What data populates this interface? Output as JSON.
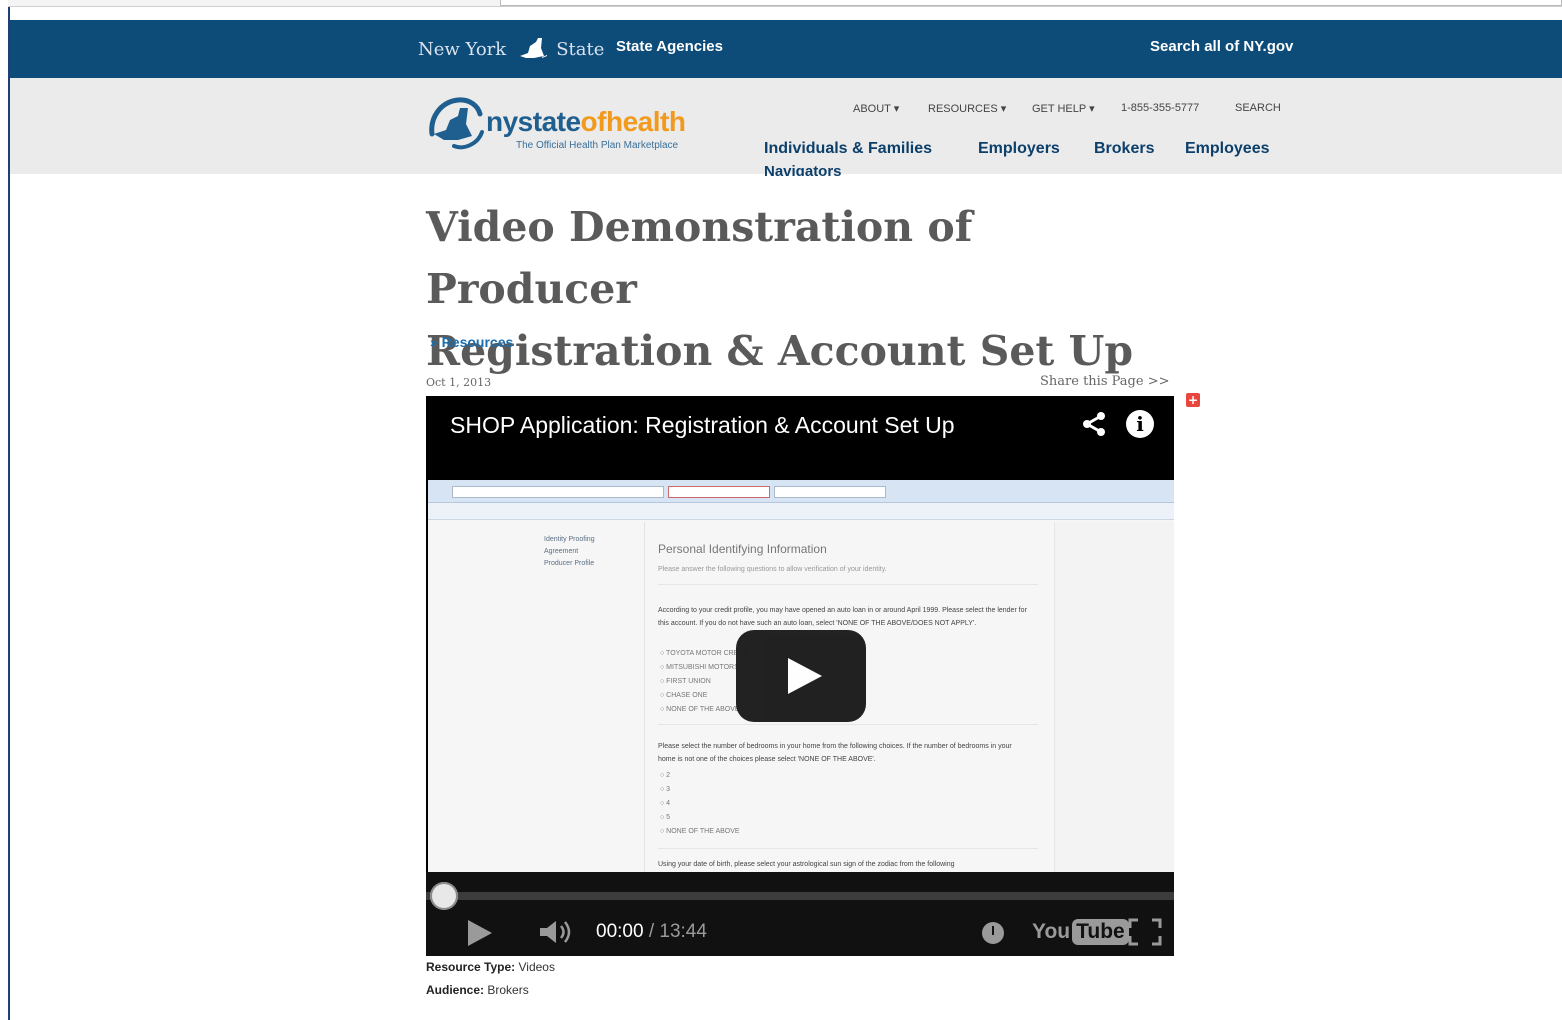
{
  "state_bar": {
    "brand_left": "New York",
    "brand_right": "State",
    "agencies": "State Agencies",
    "search": "Search all of NY.gov"
  },
  "site": {
    "logo_part1": "nystate",
    "logo_part2": "ofhealth",
    "logo_tagline": "The Official Health Plan Marketplace",
    "util_nav": [
      "ABOUT ▾",
      "RESOURCES ▾",
      "GET HELP ▾",
      "1-855-355-5777",
      "SEARCH"
    ],
    "main_nav": [
      "Individuals & Families",
      "Employers",
      "Brokers",
      "Employees",
      "Navigators"
    ]
  },
  "page": {
    "title_line1": "Video Demonstration of Producer",
    "title_line2": "Registration & Account Set Up",
    "breadcrumb": "» Resources",
    "date": "Oct 1, 2013",
    "share": "Share this Page >>"
  },
  "video": {
    "title": "SHOP Application: Registration & Account Set Up",
    "time_current": "00:00",
    "time_total": "/ 13:44",
    "progress": 0.0,
    "brand": "You",
    "brand_tube": "Tube",
    "thumbnail": {
      "side_items": [
        "Identity Proofing",
        "Agreement",
        "Producer Profile"
      ],
      "section_title": "Personal Identifying Information",
      "hint": "Please answer the following questions to allow verification of your identity.",
      "question1": "According to your credit profile, you may have opened an auto loan in or around April 1999. Please select the lender for this account. If you do not have such an auto loan, select 'NONE OF THE ABOVE/DOES NOT APPLY'.",
      "options1": [
        "○ TOYOTA MOTOR CREDIT",
        "○ MITSUBISHI MOTORS",
        "○ FIRST UNION",
        "○ CHASE ONE",
        "○ NONE OF THE ABOVE"
      ],
      "question2": "Please select the number of bedrooms in your home from the following choices. If the number of bedrooms in your home is not one of the choices please select 'NONE OF THE ABOVE'.",
      "options2": [
        "○ 2",
        "○ 3",
        "○ 4",
        "○ 5",
        "○ NONE OF THE ABOVE"
      ],
      "question3": "Using your date of birth, please select your astrological sun sign of the zodiac from the following"
    }
  },
  "meta": {
    "resource_type_label": "Resource Type:",
    "resource_type_value": "Videos",
    "audience_label": "Audience:",
    "audience_value": "Brokers"
  }
}
